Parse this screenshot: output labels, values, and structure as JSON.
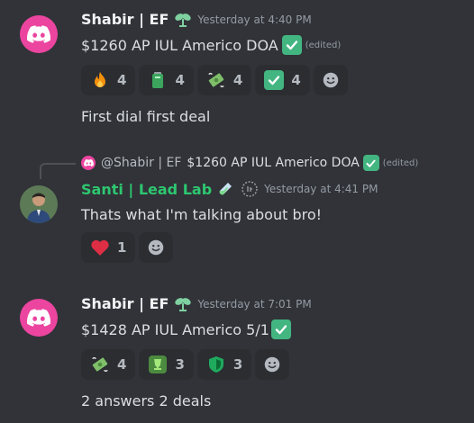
{
  "messages": [
    {
      "author": "Shabir | EF",
      "timestamp": "Yesterday at 4:40 PM",
      "text": "$1260 AP IUL Americo DOA",
      "edited": "(edited)",
      "reactions": [
        {
          "emoji": "fire-icon",
          "count": "4"
        },
        {
          "emoji": "battery-icon",
          "count": "4"
        },
        {
          "emoji": "money-wings-icon",
          "count": "4"
        },
        {
          "emoji": "check-mark-icon",
          "count": "4"
        }
      ],
      "followup": "First dial first deal"
    },
    {
      "reply": {
        "author": "@Shabir | EF",
        "text": "$1260 AP IUL Americo DOA",
        "edited": "(edited)"
      },
      "author": "Santi | Lead Lab",
      "timestamp": "Yesterday at 4:41 PM",
      "text": "Thats what I'm talking about bro!",
      "reactions": [
        {
          "emoji": "heart-icon",
          "count": "1"
        }
      ]
    },
    {
      "author": "Shabir | EF",
      "timestamp": "Yesterday at 7:01 PM",
      "text": "$1428 AP IUL Americo 5/1",
      "reactions": [
        {
          "emoji": "money-wings-icon",
          "count": "4"
        },
        {
          "emoji": "trophy-icon",
          "count": "3"
        },
        {
          "emoji": "shield-icon",
          "count": "3"
        }
      ],
      "followup": "2 answers 2 deals"
    }
  ],
  "colors": {
    "background": "#313338",
    "brand": "#eb459f",
    "username_green": "#2dc770",
    "check_green": "#43b581"
  }
}
